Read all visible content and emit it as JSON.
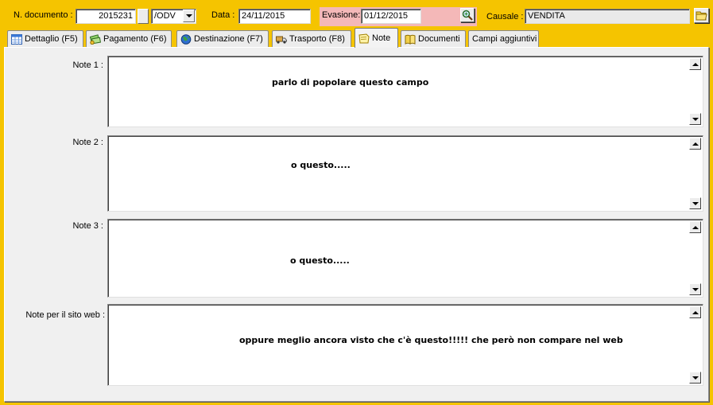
{
  "header": {
    "doc_number_label": "N. documento :",
    "doc_number_value": "2015231",
    "series_value": "/ODV",
    "date_label": "Data :",
    "date_value": "24/11/2015",
    "evasione_label": "Evasione:",
    "evasione_value": "01/12/2015",
    "causale_label": "Causale :",
    "causale_value": "VENDITA"
  },
  "tabs": [
    {
      "label": "Dettaglio (F5)",
      "icon": "grid-icon"
    },
    {
      "label": "Pagamento (F6)",
      "icon": "money-icon"
    },
    {
      "label": "Destinazione (F7)",
      "icon": "globe-icon"
    },
    {
      "label": "Trasporto (F8)",
      "icon": "truck-icon"
    },
    {
      "label": "Note",
      "icon": "note-icon",
      "active": true
    },
    {
      "label": "Documenti",
      "icon": "book-icon"
    },
    {
      "label": "Campi aggiuntivi",
      "icon": ""
    }
  ],
  "notes": [
    {
      "label": "Note 1 :",
      "text": "parlo di popolare questo campo"
    },
    {
      "label": "Note 2 :",
      "text": "o questo....."
    },
    {
      "label": "Note 3 :",
      "text": "o questo....."
    },
    {
      "label": "Note per il sito web :",
      "text": "oppure meglio ancora visto che c'è questo!!!!! che però non compare nel web"
    }
  ],
  "colors": {
    "background": "#f5c400",
    "evasione_highlight": "#f4b8b8",
    "panel": "#f0f0f0"
  }
}
